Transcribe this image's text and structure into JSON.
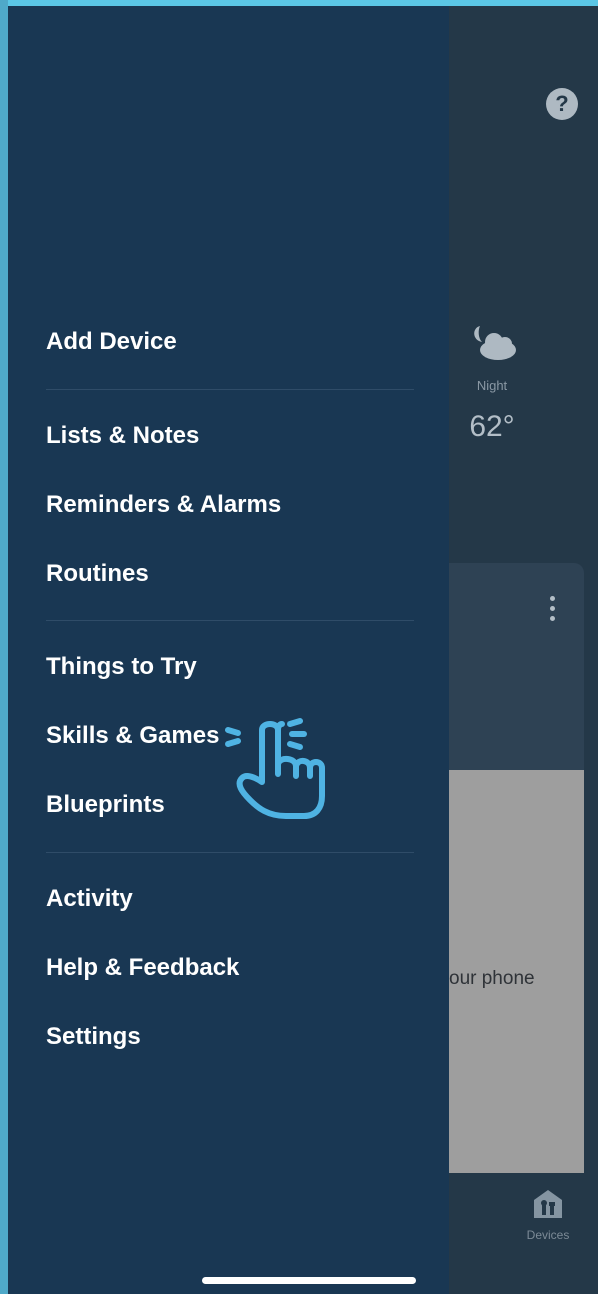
{
  "background": {
    "weather": {
      "period": "Night",
      "temperature": "62°",
      "icon": "moon-cloud-icon"
    },
    "card": {
      "text": "our phone",
      "menu_icon": "vertical-dots-icon"
    },
    "bottom_nav": {
      "devices_label": "Devices",
      "devices_icon": "devices-icon"
    },
    "help_icon": "help-icon",
    "help_glyph": "?"
  },
  "drawer": {
    "groups": [
      {
        "items": [
          "Add Device"
        ]
      },
      {
        "items": [
          "Lists & Notes",
          "Reminders & Alarms",
          "Routines"
        ]
      },
      {
        "items": [
          "Things to Try",
          "Skills & Games",
          "Blueprints"
        ]
      },
      {
        "items": [
          "Activity",
          "Help & Feedback",
          "Settings"
        ]
      }
    ]
  },
  "overlay": {
    "tap_icon": "tap-hand-icon",
    "target": "Skills & Games"
  },
  "colors": {
    "drawer_bg": "#193753",
    "background_app": "#243848",
    "accent": "#4fb3e3",
    "text": "#ffffff"
  }
}
